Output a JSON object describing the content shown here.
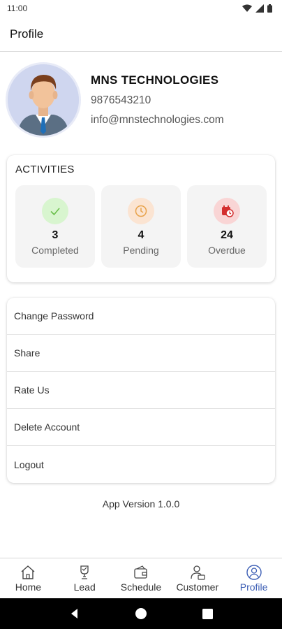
{
  "status_bar": {
    "time": "11:00"
  },
  "app_bar": {
    "title": "Profile"
  },
  "profile": {
    "company": "MNS TECHNOLOGIES",
    "phone": "9876543210",
    "email": "info@mnstechnologies.com"
  },
  "activities": {
    "title": "ACTIVITIES",
    "items": [
      {
        "count": "3",
        "label": "Completed",
        "icon": "check-icon",
        "color": "#6abf4b",
        "bg": "#d8f5cf"
      },
      {
        "count": "4",
        "label": "Pending",
        "icon": "clock-icon",
        "color": "#e8a24a",
        "bg": "#fbe4d2"
      },
      {
        "count": "24",
        "label": "Overdue",
        "icon": "overdue-icon",
        "color": "#d32f2f",
        "bg": "#f9d5d5"
      }
    ]
  },
  "menu": {
    "items": [
      {
        "label": "Change Password"
      },
      {
        "label": "Share"
      },
      {
        "label": "Rate Us"
      },
      {
        "label": "Delete Account"
      },
      {
        "label": "Logout"
      }
    ]
  },
  "app_version": "App Version 1.0.0",
  "bottom_nav": {
    "active_color": "#3d5fb5",
    "items": [
      {
        "label": "Home",
        "icon": "home-icon"
      },
      {
        "label": "Lead",
        "icon": "lead-icon"
      },
      {
        "label": "Schedule",
        "icon": "schedule-icon"
      },
      {
        "label": "Customer",
        "icon": "customer-icon"
      },
      {
        "label": "Profile",
        "icon": "profile-icon",
        "active": true
      }
    ]
  }
}
